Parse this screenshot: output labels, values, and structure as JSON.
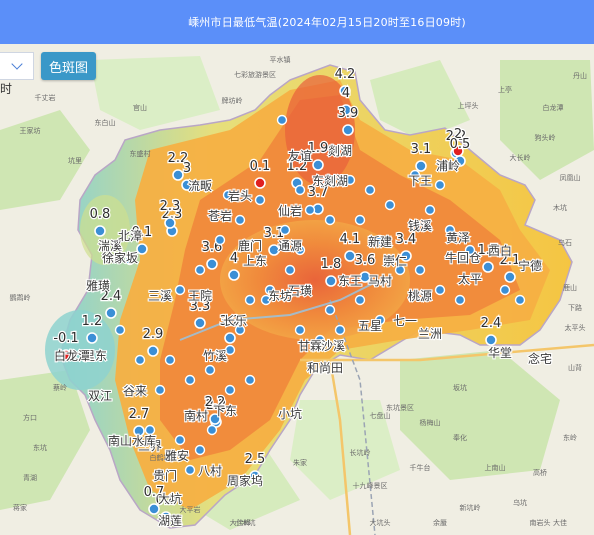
{
  "header": {
    "title": "嵊州市日最低气温(2024年02月15日20时至16日09时)"
  },
  "controls": {
    "dropdown_label": "",
    "side_label": "时",
    "contour_button": "色斑图"
  },
  "colors": {
    "header_bg": "#5b8ff9",
    "station_normal": "#3b8fd6",
    "station_alert": "#e02020",
    "temp_low": "#8ed2cf",
    "temp_mid": "#f5c542",
    "temp_high": "#f08a3c",
    "temp_peak": "#e8603a"
  },
  "stations": [
    {
      "label": "4.2",
      "alert": false
    },
    {
      "label": "4",
      "alert": false
    },
    {
      "label": "3.9",
      "alert": false
    },
    {
      "label": "2.2",
      "alert": false
    },
    {
      "label": "3",
      "alert": false
    },
    {
      "label": "2.3",
      "alert": false
    },
    {
      "label": "0.1",
      "alert": true
    },
    {
      "label": "1.2",
      "alert": false
    },
    {
      "label": "2.2",
      "alert": false
    },
    {
      "label": "3.1",
      "alert": false
    },
    {
      "label": "2",
      "alert": true
    },
    {
      "label": "0.5",
      "alert": false
    },
    {
      "label": "3.6",
      "alert": false
    },
    {
      "label": "3.7",
      "alert": false
    },
    {
      "label": "1.9",
      "alert": false
    },
    {
      "label": "0.8",
      "alert": false
    },
    {
      "label": "0.1",
      "alert": false
    },
    {
      "label": "1.8",
      "alert": false
    },
    {
      "label": "4.1",
      "alert": false
    },
    {
      "label": "3.4",
      "alert": false
    },
    {
      "label": "3.6",
      "alert": false
    },
    {
      "label": "2.4",
      "alert": false
    },
    {
      "label": "2.1",
      "alert": false
    },
    {
      "label": "1.2",
      "alert": false
    },
    {
      "label": "-0.1",
      "alert": true
    },
    {
      "label": "2.9",
      "alert": false
    },
    {
      "label": "2.7",
      "alert": false
    },
    {
      "label": "2.2",
      "alert": false
    },
    {
      "label": "2.5",
      "alert": false
    },
    {
      "label": "0.7",
      "alert": false
    },
    {
      "label": "0.8",
      "alert": false
    },
    {
      "label": "4",
      "alert": false
    },
    {
      "label": "3.1",
      "alert": false
    },
    {
      "label": "2.4",
      "alert": false
    },
    {
      "label": "2.2",
      "alert": false
    },
    {
      "label": "1.7",
      "alert": false
    },
    {
      "label": "3.3",
      "alert": false
    },
    {
      "label": "3.2",
      "alert": false
    },
    {
      "label": "2.3",
      "alert": false
    }
  ],
  "places": [
    "湍溪",
    "仙岩",
    "友谊",
    "剡湖",
    "东剡湖",
    "下王",
    "浦岭",
    "贵门",
    "石璜",
    "王院",
    "甘霖",
    "长乐",
    "崇仁",
    "谷来",
    "雅璜",
    "徐家坂",
    "三溪",
    "竹溪",
    "里东",
    "白龙潭",
    "钱溪",
    "黄泽",
    "北漳",
    "通源",
    "东王",
    "牛回仓",
    "西白",
    "宁德",
    "苍岩",
    "三界",
    "兰洲",
    "华堂",
    "念宅",
    "七一",
    "下东",
    "南山水库",
    "雅安",
    "八村",
    "周家坞",
    "湖莲",
    "流畈",
    "五星",
    "太平",
    "沙溪",
    "桃源",
    "岩头",
    "东坊",
    "马村",
    "上东",
    "新建",
    "小坑",
    "和尚田",
    "鹿门",
    "南村",
    "双江",
    "大坑"
  ],
  "landmarks": [
    "丹山",
    "上亭",
    "上坪头",
    "白龙潭",
    "狗头岭",
    "凤凰山",
    "乌石",
    "鹿山",
    "下路",
    "太平头",
    "东盛村",
    "王家坊",
    "官山",
    "七彩旅游景区",
    "牌坊岭",
    "坑里",
    "平水镇",
    "大长岭",
    "十九峰景区",
    "七盘山",
    "奉化",
    "大佳峰",
    "白鹤坑",
    "大平岩",
    "小木坑",
    "蔡岭",
    "方口",
    "东坑",
    "杨梅山",
    "坂坑",
    "东坑景区",
    "长坑岭",
    "千牛台",
    "新坑岭",
    "乌坑",
    "高桥",
    "东岭",
    "青湖",
    "蒋家",
    "木坑",
    "南岩头",
    "鹦鹉岭",
    "大佳",
    "大坑头",
    "朱家",
    "余蜃",
    "东白山",
    "千丈岩",
    "山背",
    "上南山"
  ]
}
